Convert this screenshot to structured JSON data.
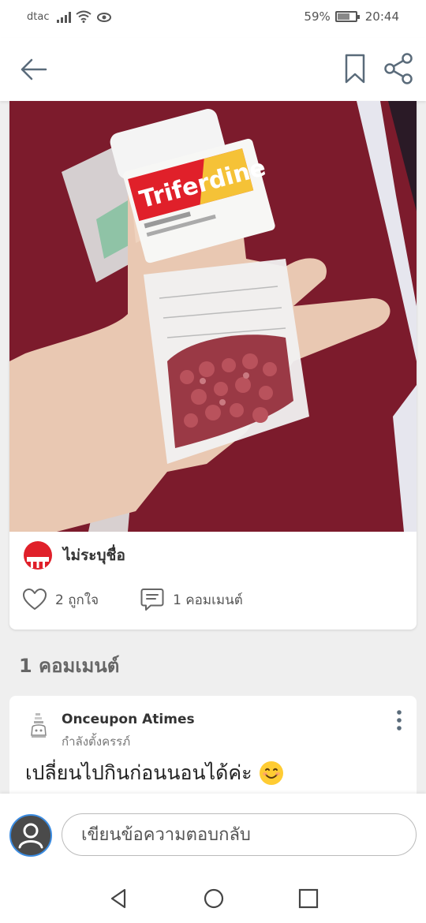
{
  "status_bar": {
    "carrier": "dtac",
    "battery": "59%",
    "time": "20:44"
  },
  "post": {
    "author_name": "ไม่ระบุชื่อ",
    "like_label": "2 ถูกใจ",
    "comment_label": "1 คอมเมนต์",
    "image_label": "Triferdine"
  },
  "comments": {
    "heading": "1 คอมเมนต์",
    "items": [
      {
        "name": "Onceupon Atimes",
        "status": "กำลังตั้งครรภ์",
        "text": "เปลี่ยนไปกินก่อนนอนได้ค่ะ"
      }
    ]
  },
  "reply": {
    "placeholder": "เขียนข้อความตอบกลับ"
  },
  "colors": {
    "brand_red": "#e0202a",
    "background": "#efefef",
    "icon_gray": "#666666"
  },
  "icons": [
    "arrow-left-icon",
    "bookmark-icon",
    "share-icon",
    "heart-icon",
    "comment-icon",
    "more-vert-icon",
    "user-avatar-icon",
    "nav-back-icon",
    "nav-home-icon",
    "nav-recents-icon"
  ]
}
